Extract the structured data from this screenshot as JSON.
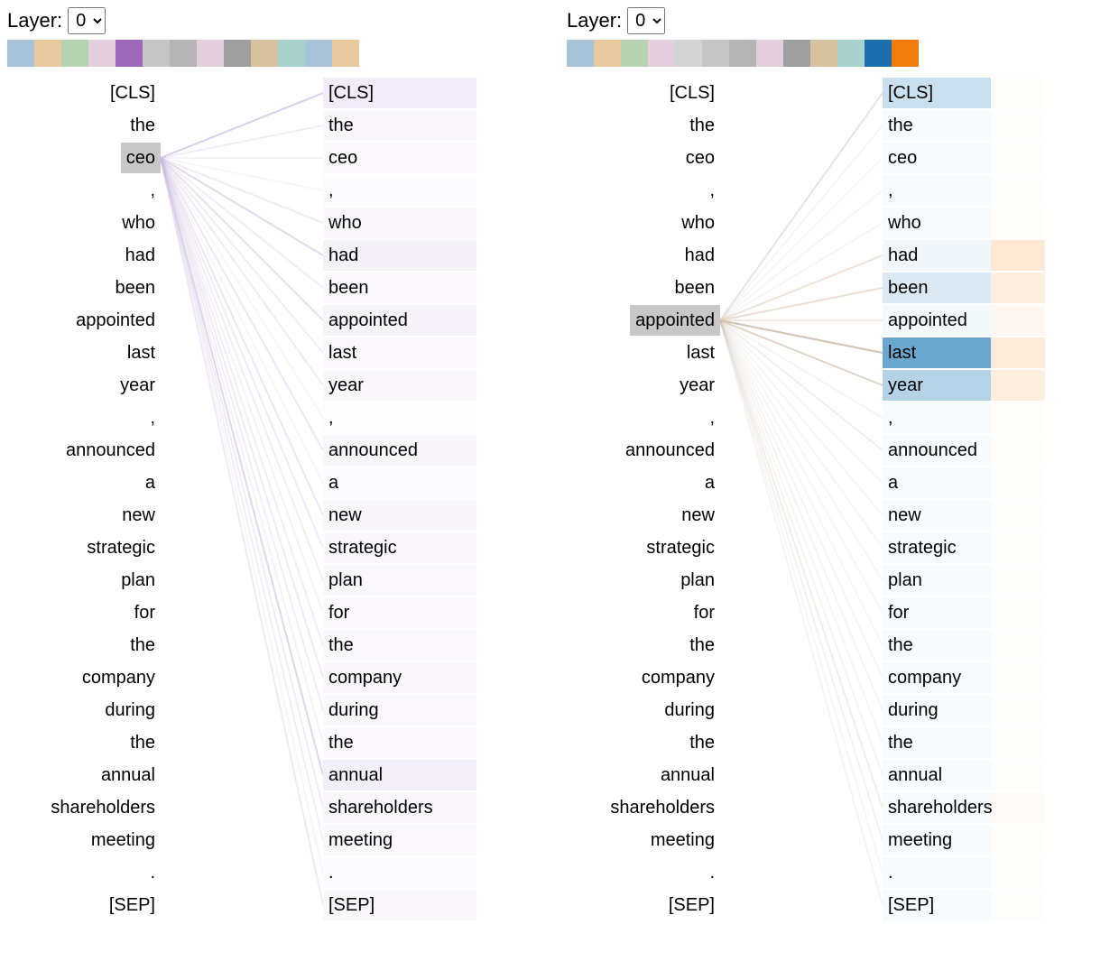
{
  "layer_label": "Layer:",
  "layer_options": [
    "0"
  ],
  "tokens": [
    "[CLS]",
    "the",
    "ceo",
    ",",
    "who",
    "had",
    "been",
    "appointed",
    "last",
    "year",
    ",",
    "announced",
    "a",
    "new",
    "strategic",
    "plan",
    "for",
    "the",
    "company",
    "during",
    "the",
    "annual",
    "shareholders",
    "meeting",
    ".",
    "[SEP]"
  ],
  "left_panel": {
    "selected_index": 2,
    "selected_token": "ceo",
    "head_colors": [
      "#a7c3da",
      "#e8c89e",
      "#b7d1b3",
      "#e4cfdd",
      "#9e68b9",
      "#c5c5c5",
      "#b4b4b4",
      "#e4cfdd",
      "#9f9f9f",
      "#d6c29e",
      "#a9d1cc",
      "#a7c3da",
      "#e8c89e"
    ],
    "right_shade_color": "#efe9f6",
    "right_shade_alpha": [
      0.85,
      0.35,
      0.25,
      0.2,
      0.35,
      0.65,
      0.3,
      0.55,
      0.3,
      0.35,
      0.15,
      0.4,
      0.2,
      0.45,
      0.35,
      0.3,
      0.25,
      0.3,
      0.35,
      0.3,
      0.25,
      0.75,
      0.35,
      0.3,
      0.2,
      0.35
    ],
    "line_color": "#cbbbe0",
    "line_alpha": [
      0.7,
      0.25,
      0.2,
      0.15,
      0.3,
      0.55,
      0.25,
      0.45,
      0.25,
      0.3,
      0.12,
      0.35,
      0.15,
      0.35,
      0.28,
      0.25,
      0.2,
      0.25,
      0.3,
      0.25,
      0.2,
      0.6,
      0.28,
      0.25,
      0.15,
      0.3
    ]
  },
  "right_panel": {
    "selected_index": 7,
    "selected_token": "appointed",
    "head_colors": [
      "#a7c3da",
      "#e8c89e",
      "#b7d1b3",
      "#e4cfdd",
      "#d3d3d3",
      "#c5c5c5",
      "#b4b4b4",
      "#e4cfdd",
      "#9f9f9f",
      "#d6c29e",
      "#a9d1cc",
      "#1c6eac",
      "#f17c0b"
    ],
    "right_shade_color_blue": "#6ba7cf",
    "right_shade_color_orange": "#fbe0c6",
    "right_blue_alpha": [
      0.35,
      0.05,
      0.05,
      0.05,
      0.05,
      0.1,
      0.25,
      0.08,
      1.0,
      0.5,
      0.05,
      0.05,
      0.05,
      0.05,
      0.05,
      0.05,
      0.05,
      0.05,
      0.05,
      0.05,
      0.05,
      0.05,
      0.05,
      0.05,
      0.05,
      0.05
    ],
    "right_orange_alpha": [
      0.1,
      0.05,
      0.05,
      0.05,
      0.1,
      0.75,
      0.55,
      0.25,
      0.65,
      0.55,
      0.1,
      0.1,
      0.05,
      0.05,
      0.05,
      0.05,
      0.05,
      0.05,
      0.05,
      0.05,
      0.05,
      0.05,
      0.15,
      0.1,
      0.05,
      0.05
    ],
    "line_color_gray": "#bdbdbd",
    "line_color_orange": "#f0c79a",
    "line_alpha": [
      0.35,
      0.1,
      0.1,
      0.1,
      0.1,
      0.25,
      0.3,
      0.2,
      0.9,
      0.5,
      0.1,
      0.18,
      0.1,
      0.1,
      0.1,
      0.1,
      0.1,
      0.1,
      0.12,
      0.12,
      0.1,
      0.12,
      0.18,
      0.15,
      0.1,
      0.12
    ]
  }
}
